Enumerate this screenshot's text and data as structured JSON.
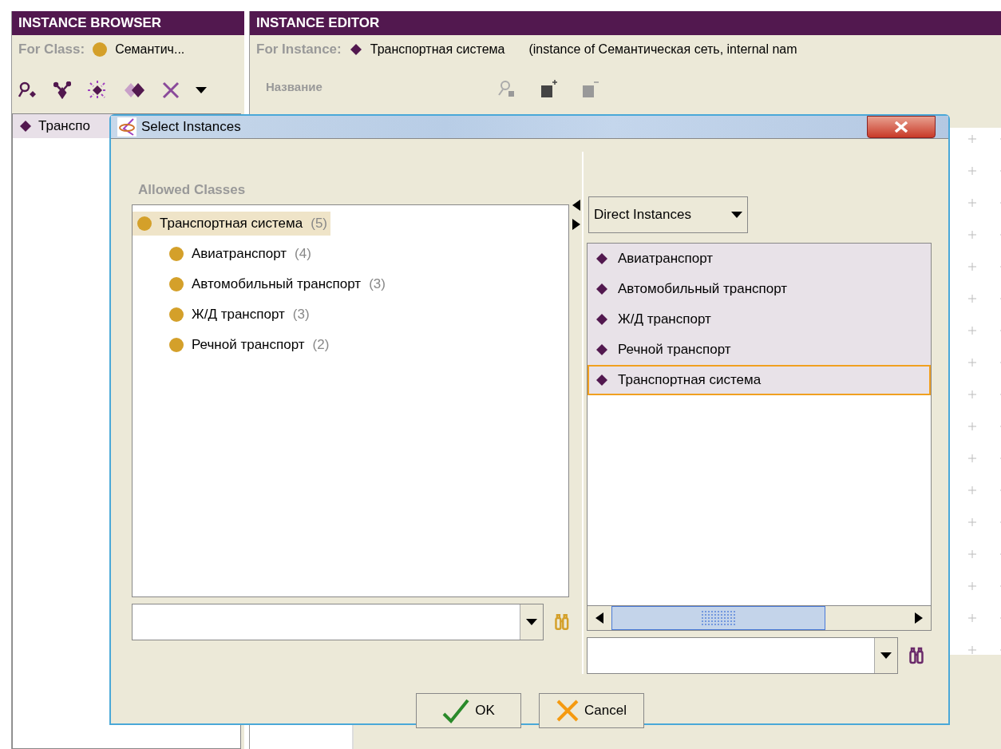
{
  "instance_browser": {
    "title": "INSTANCE BROWSER",
    "for_class_label": "For Class:",
    "for_class_value": "Семантич...",
    "items": [
      {
        "label": "Транспо",
        "selected": true
      }
    ]
  },
  "instance_editor": {
    "title": "INSTANCE EDITOR",
    "for_instance_label": "For Instance:",
    "instance_name": "Транспортная система",
    "instance_info": "(instance of Семантическая сеть, internal nam",
    "field_label": "Название"
  },
  "dialog": {
    "title": "Select Instances",
    "allowed_classes_label": "Allowed Classes",
    "class_tree": [
      {
        "label": "Транспортная система",
        "count": "(5)",
        "selected": true,
        "children": [
          {
            "label": "Авиатранспорт",
            "count": "(4)",
            "selected": false
          },
          {
            "label": "Автомобильный транспорт",
            "count": "(3)",
            "selected": false
          },
          {
            "label": "Ж/Д транспорт",
            "count": "(3)",
            "selected": false
          },
          {
            "label": "Речной транспорт",
            "count": "(2)",
            "selected": false
          }
        ]
      }
    ],
    "view_selector": "Direct Instances",
    "instances": [
      {
        "label": "Авиатранспорт",
        "selected": true,
        "focused": false
      },
      {
        "label": "Автомобильный транспорт",
        "selected": true,
        "focused": false
      },
      {
        "label": "Ж/Д транспорт",
        "selected": true,
        "focused": false
      },
      {
        "label": "Речной транспорт",
        "selected": true,
        "focused": false
      },
      {
        "label": "Транспортная система",
        "selected": true,
        "focused": true
      }
    ],
    "buttons": [
      {
        "kind": "ok",
        "label": "OK"
      },
      {
        "kind": "cancel",
        "label": "Cancel"
      }
    ]
  }
}
